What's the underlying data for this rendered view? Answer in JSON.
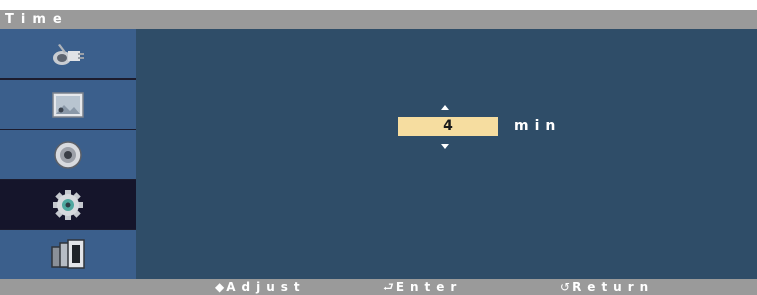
{
  "header": {
    "title": "Time"
  },
  "sidebar": {
    "items": [
      {
        "icon": "input-plug-icon",
        "selected": false
      },
      {
        "icon": "picture-icon",
        "selected": false
      },
      {
        "icon": "speaker-sound-icon",
        "selected": false
      },
      {
        "icon": "gear-setup-icon",
        "selected": true
      },
      {
        "icon": "multi-screen-icon",
        "selected": false
      }
    ]
  },
  "setting": {
    "value": "4",
    "unit": "min",
    "up_icon": "triangle-up-icon",
    "down_icon": "triangle-down-icon"
  },
  "footer": {
    "adjust": {
      "icon": "◆",
      "label": "Adjust"
    },
    "enter": {
      "icon": "⮐",
      "label": "Enter"
    },
    "return": {
      "icon": "↺",
      "label": "Return"
    }
  },
  "colors": {
    "title_bar": "#9a9a9a",
    "menu_item": "#3b5f8c",
    "menu_selected": "#15152b",
    "content_bg": "#2f4d68",
    "value_box": "#f6dda0"
  }
}
